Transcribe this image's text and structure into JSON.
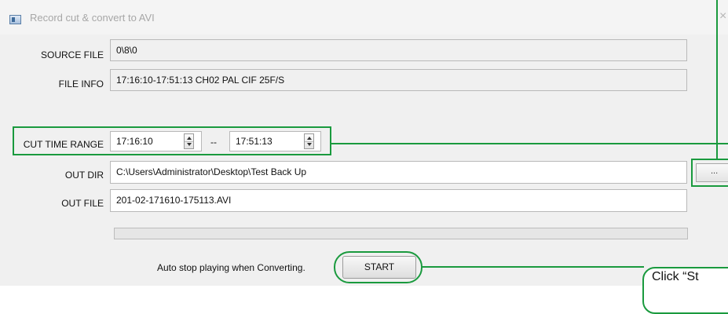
{
  "window": {
    "title": "Record cut & convert to AVI",
    "close_glyph": "×",
    "app_icon": "film-window-icon"
  },
  "form": {
    "source_file": {
      "label": "SOURCE FILE",
      "value": "0\\8\\0"
    },
    "file_info": {
      "label": "FILE INFO",
      "value": "17:16:10-17:51:13 CH02 PAL CIF 25F/S"
    },
    "cut_time_range": {
      "label": "CUT TIME RANGE",
      "start": "17:16:10",
      "separator": "--",
      "end": "17:51:13"
    },
    "out_dir": {
      "label": "OUT DIR",
      "value": "C:\\Users\\Administrator\\Desktop\\Test Back Up",
      "browse_label": "..."
    },
    "out_file": {
      "label": "OUT FILE",
      "value": "201-02-171610-175113.AVI"
    }
  },
  "progress": {
    "percent": 0
  },
  "footer": {
    "auto_stop_text": "Auto stop playing when Converting.",
    "start_label": "START"
  },
  "annotation": {
    "callout_text": "Click “St",
    "highlight_color": "#1a9a3e"
  }
}
